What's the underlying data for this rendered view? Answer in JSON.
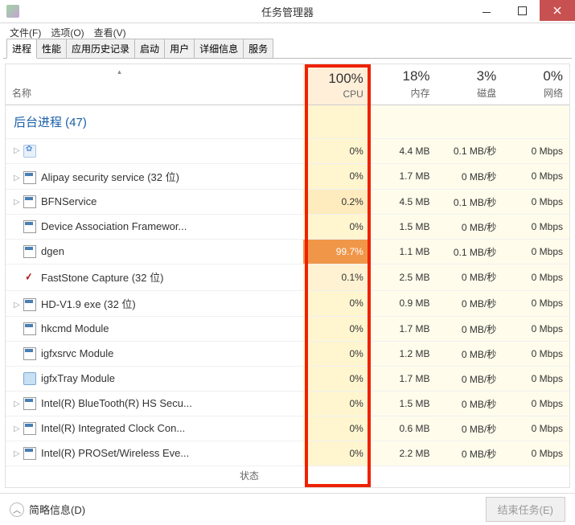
{
  "window": {
    "title": "任务管理器"
  },
  "menu": {
    "file": "文件(F)",
    "options": "选项(O)",
    "view": "查看(V)"
  },
  "tabs": [
    {
      "label": "进程",
      "active": true
    },
    {
      "label": "性能",
      "active": false
    },
    {
      "label": "应用历史记录",
      "active": false
    },
    {
      "label": "启动",
      "active": false
    },
    {
      "label": "用户",
      "active": false
    },
    {
      "label": "详细信息",
      "active": false
    },
    {
      "label": "服务",
      "active": false
    }
  ],
  "columns": {
    "name": "名称",
    "status": "状态",
    "cpu": {
      "pct": "100%",
      "label": "CPU"
    },
    "mem": {
      "pct": "18%",
      "label": "内存"
    },
    "disk": {
      "pct": "3%",
      "label": "磁盘"
    },
    "net": {
      "pct": "0%",
      "label": "网络"
    }
  },
  "group": {
    "label": "后台进程 (47)"
  },
  "rows": [
    {
      "expand": true,
      "icon": "gear",
      "name": "",
      "cpu": "0%",
      "cpulvl": "",
      "mem": "4.4 MB",
      "disk": "0.1 MB/秒",
      "net": "0 Mbps"
    },
    {
      "expand": true,
      "icon": "exe",
      "name": "Alipay security service (32 位)",
      "cpu": "0%",
      "cpulvl": "",
      "mem": "1.7 MB",
      "disk": "0 MB/秒",
      "net": "0 Mbps"
    },
    {
      "expand": true,
      "icon": "exe",
      "name": "BFNService",
      "cpu": "0.2%",
      "cpulvl": "low1",
      "mem": "4.5 MB",
      "disk": "0.1 MB/秒",
      "net": "0 Mbps"
    },
    {
      "expand": false,
      "icon": "exe",
      "name": "Device Association Framewor...",
      "cpu": "0%",
      "cpulvl": "",
      "mem": "1.5 MB",
      "disk": "0 MB/秒",
      "net": "0 Mbps"
    },
    {
      "expand": false,
      "icon": "exe",
      "name": "dgen",
      "cpu": "99.7%",
      "cpulvl": "high",
      "mem": "1.1 MB",
      "disk": "0.1 MB/秒",
      "net": "0 Mbps"
    },
    {
      "expand": false,
      "icon": "fs",
      "name": "FastStone Capture (32 位)",
      "cpu": "0.1%",
      "cpulvl": "low2",
      "mem": "2.5 MB",
      "disk": "0 MB/秒",
      "net": "0 Mbps"
    },
    {
      "expand": true,
      "icon": "exe",
      "name": "HD-V1.9 exe (32 位)",
      "cpu": "0%",
      "cpulvl": "",
      "mem": "0.9 MB",
      "disk": "0 MB/秒",
      "net": "0 Mbps"
    },
    {
      "expand": false,
      "icon": "exe",
      "name": "hkcmd Module",
      "cpu": "0%",
      "cpulvl": "",
      "mem": "1.7 MB",
      "disk": "0 MB/秒",
      "net": "0 Mbps"
    },
    {
      "expand": false,
      "icon": "exe",
      "name": "igfxsrvc Module",
      "cpu": "0%",
      "cpulvl": "",
      "mem": "1.2 MB",
      "disk": "0 MB/秒",
      "net": "0 Mbps"
    },
    {
      "expand": false,
      "icon": "tray",
      "name": "igfxTray Module",
      "cpu": "0%",
      "cpulvl": "",
      "mem": "1.7 MB",
      "disk": "0 MB/秒",
      "net": "0 Mbps"
    },
    {
      "expand": true,
      "icon": "exe",
      "name": "Intel(R) BlueTooth(R) HS Secu...",
      "cpu": "0%",
      "cpulvl": "",
      "mem": "1.5 MB",
      "disk": "0 MB/秒",
      "net": "0 Mbps"
    },
    {
      "expand": true,
      "icon": "exe",
      "name": "Intel(R) Integrated Clock Con...",
      "cpu": "0%",
      "cpulvl": "",
      "mem": "0.6 MB",
      "disk": "0 MB/秒",
      "net": "0 Mbps"
    },
    {
      "expand": true,
      "icon": "exe",
      "name": "Intel(R) PROSet/Wireless Eve...",
      "cpu": "0%",
      "cpulvl": "",
      "mem": "2.2 MB",
      "disk": "0 MB/秒",
      "net": "0 Mbps"
    }
  ],
  "footer": {
    "brief": "简略信息(D)",
    "endtask": "结束任务(E)"
  }
}
